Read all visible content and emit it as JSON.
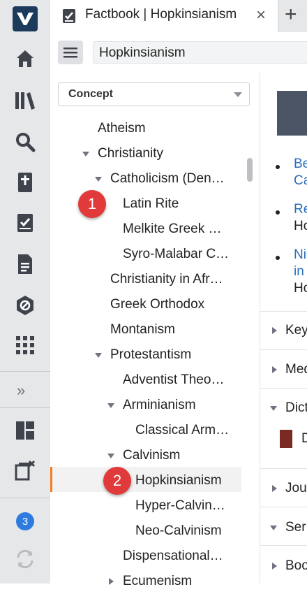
{
  "tab": {
    "title": "Factbook | Hopkinsianism",
    "close": "×",
    "add": "+"
  },
  "search": {
    "value": "Hopkinsianism"
  },
  "concept_select": {
    "value": "Concept"
  },
  "tree": [
    {
      "label": "Atheism",
      "level": 1,
      "expander": "none"
    },
    {
      "label": "Christianity",
      "level": 1,
      "expander": "expanded"
    },
    {
      "label": "Catholicism (Den…",
      "level": 2,
      "expander": "expanded"
    },
    {
      "label": "Latin Rite",
      "level": 3,
      "expander": "none"
    },
    {
      "label": "Melkite Greek …",
      "level": 3,
      "expander": "none"
    },
    {
      "label": "Syro-Malabar C…",
      "level": 3,
      "expander": "none"
    },
    {
      "label": "Christianity in Afr…",
      "level": 2,
      "expander": "none"
    },
    {
      "label": "Greek Orthodox",
      "level": 2,
      "expander": "none"
    },
    {
      "label": "Montanism",
      "level": 2,
      "expander": "none"
    },
    {
      "label": "Protestantism",
      "level": 2,
      "expander": "expanded"
    },
    {
      "label": "Adventist Theo…",
      "level": 3,
      "expander": "none"
    },
    {
      "label": "Arminianism",
      "level": 3,
      "expander": "expanded"
    },
    {
      "label": "Classical Arm…",
      "level": 4,
      "expander": "none"
    },
    {
      "label": "Calvinism",
      "level": 3,
      "expander": "expanded"
    },
    {
      "label": "Hopkinsianism",
      "level": 4,
      "expander": "none",
      "selected": true
    },
    {
      "label": "Hyper-Calvin…",
      "level": 4,
      "expander": "none"
    },
    {
      "label": "Neo-Calvinism",
      "level": 4,
      "expander": "none"
    },
    {
      "label": "Dispensational…",
      "level": 3,
      "expander": "none"
    },
    {
      "label": "Ecumenism",
      "level": 3,
      "expander": "collapsed"
    }
  ],
  "markers": [
    "1",
    "2"
  ],
  "rail": {
    "badge_count": "3",
    "collapse_glyph": "»"
  },
  "content": {
    "links": [
      {
        "line1": "Be",
        "line2": "Ca",
        "extra": ""
      },
      {
        "line1": "Re",
        "line2": "",
        "extra": "Ho"
      },
      {
        "line1": "Ni",
        "line2": "in",
        "extra": "Ho"
      }
    ],
    "sections": [
      {
        "label": "Key",
        "state": "collapsed"
      },
      {
        "label": "Med",
        "state": "collapsed"
      },
      {
        "label": "Dict",
        "state": "expanded",
        "item": "D"
      },
      {
        "label": "Jou",
        "state": "collapsed"
      },
      {
        "label": "Ser",
        "state": "expanded"
      },
      {
        "label": "Boo",
        "state": "collapsed"
      }
    ]
  },
  "colors": {
    "accent_selection": "#f47b20",
    "marker": "#e03a3a",
    "link": "#2a6ebb",
    "logo_bg": "#1b3a5c",
    "badge": "#2e7be0"
  },
  "icons": [
    "logo-icon",
    "home-icon",
    "library-icon",
    "search-icon",
    "bible-icon",
    "factbook-icon",
    "document-icon",
    "atlas-icon",
    "apps-grid-icon",
    "layout-icon",
    "close-panels-icon",
    "sync-icon",
    "checkbook-icon",
    "speech-bubble-icon",
    "book-cover-icon"
  ]
}
